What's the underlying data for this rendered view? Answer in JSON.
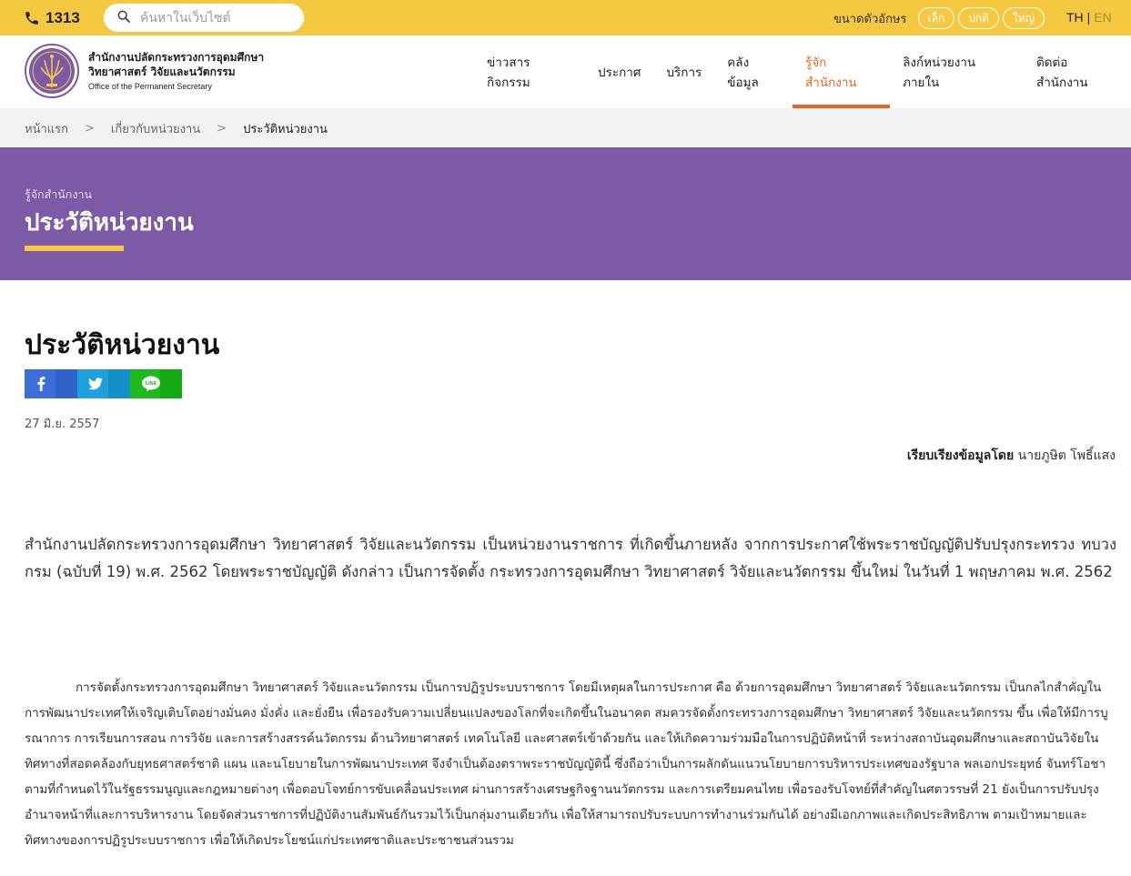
{
  "topbar": {
    "hotline": "1313",
    "search_placeholder": "ค้นหาในเว็บไซต์",
    "font_size_label": "ขนาดตัวอักษร",
    "font_small": "เล็ก",
    "font_normal": "ปกติ",
    "font_large": "ใหญ่",
    "lang_th": "TH",
    "lang_sep": "|",
    "lang_en": "EN"
  },
  "header": {
    "org_line1": "สำนักงานปลัดกระทรวงการอุดมศึกษา",
    "org_line2": "วิทยาศาสตร์ วิจัยและนวัตกรรม",
    "org_en": "Office of the Permanent Secretary",
    "nav": [
      "ข่าวสารกิจกรรม",
      "ประกาศ",
      "บริการ",
      "คลังข้อมูล",
      "รู้จักสำนักงาน",
      "ลิงก์หน่วยงานภายใน",
      "ติดต่อสำนักงาน"
    ],
    "active_nav": 4
  },
  "breadcrumb": {
    "home": "หน้าแรก",
    "parent": "เกี่ยวกับหน่วยงาน",
    "current": "ประวัติหน่วยงาน",
    "sep": ">"
  },
  "banner": {
    "subtitle": "รู้จักสำนักงาน",
    "title": "ประวัติหน่วยงาน"
  },
  "colors": {
    "topbar": "#f5c842",
    "banner": "#7c5aa6",
    "accent": "#e8641e"
  },
  "article": {
    "title": "ประวัติหน่วยงาน",
    "share": {
      "facebook": "facebook-share",
      "twitter": "twitter-share",
      "line": "LINE"
    },
    "date": "27 มิ.ย. 2557",
    "compiled_label": "เรียบเรียงข้อมูลโดย",
    "compiled_by": "นายภูษิต โพธิ์แสง",
    "lead": "สำนักงานปลัดกระทรวงการอุดมศึกษา วิทยาศาสตร์ วิจัยและนวัตกรรม เป็นหน่วยงานราชการ ที่เกิดขึ้นภายหลัง จากการประกาศใช้พระราชบัญญัติปรับปรุงกระทรวง ทบวง กรม (ฉบับที่ 19) พ.ศ. 2562  โดยพระราชบัญญัติ ดังกล่าว เป็นการจัดตั้ง กระทรวงการอุดมศึกษา วิทยาศาสตร์ วิจัยและนวัตกรรม ขึ้นใหม่ ในวันที่ 1 พฤษภาคม พ.ศ. 2562",
    "body": "การจัดตั้งกระทรวงการอุดมศึกษา วิทยาศาสตร์ วิจัยและนวัตกรรม เป็นการปฏิรูประบบราชการ โดยมีเหตุผลในการประกาศ คือ ด้วยการอุดมศึกษา วิทยาศาสตร์ วิจัยและนวัตกรรม เป็นกลไกสำคัญในการพัฒนาประเทศให้เจริญเติบโตอย่างมั่นคง มั่งคั่ง และยั่งยืน เพื่อรองรับความเปลี่ยนแปลงของโลกที่จะเกิดขึ้นในอนาคต สมควรจัดตั้งกระทรวงการอุดมศึกษา วิทยาศาสตร์ วิจัยและนวัตกรรม ขึ้น เพื่อให้มีการบูรณาการ การเรียนการสอน การวิจัย และการสร้างสรรค์นวัตกรรม ด้านวิทยาศาสตร์ เทคโนโลยี และศาสตร์เข้าด้วยกัน และให้เกิดความร่วมมือในการปฏิบัติหน้าที่ ระหว่างสถาบันอุดมศึกษาและสถาบันวิจัยในทิศทางที่สอดคล้องกับยุทธศาสตร์ชาติ แผน และนโยบายในการพัฒนาประเทศ จึงจำเป็นต้องตราพระราชบัญญัตินี้ ซึ่งถือว่าเป็นการผลักดันแนวนโยบายการบริหารประเทศของรัฐบาล พลเอกประยุทธ์ จันทร์โอชา ตามที่กำหนดไว้ในรัฐธรรมนูญและกฎหมายต่างๆ เพื่อตอบโจทย์การขับเคลื่อนประเทศ ผ่านการสร้างเศรษฐกิจฐานนวัตกรรม และการเตรียมคนไทย เพื่อรองรับโจทย์ที่สำคัญในศตวรรษที่ 21 ยังเป็นการปรับปรุงอำนาจหน้าที่และการบริหารงาน โดยจัดส่วนราชการที่ปฏิบัติงานสัมพันธ์กันรวมไว้เป็นกลุ่มงานเดียวกัน เพื่อให้สามารถปรับระบบการทำงานร่วมกันได้ อย่างมีเอกภาพและเกิดประสิทธิภาพ ตามเป้าหมายและทิศทางของการปฏิรูประบบราชการ เพื่อให้เกิดประโยชน์แก่ประเทศชาติและประชาชนส่วนรวม"
  }
}
